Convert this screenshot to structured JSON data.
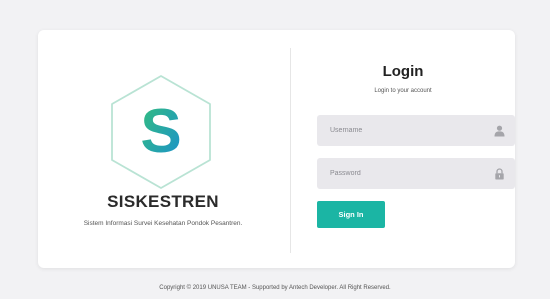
{
  "brand": {
    "logo_letter": "S",
    "name": "SISKESTREN",
    "subtitle": "Sistem Informasi Survei Kesehatan Pondok Pesantren."
  },
  "login": {
    "title": "Login",
    "subtitle": "Login to your account",
    "username_placeholder": "Username",
    "password_placeholder": "Password",
    "signin_label": "Sign In",
    "username_icon": "user-icon",
    "password_icon": "lock-icon"
  },
  "footer": {
    "text": "Copyright © 2019 UNUSA TEAM - Supported by Antech Developer. All Right Reserved."
  },
  "colors": {
    "accent": "#1bb5a4",
    "logo_gradient_start": "#35c07a",
    "logo_gradient_end": "#1a8fd0",
    "hexagon_stroke": "#b9e3d4",
    "field_bg": "#e9e8ec",
    "page_bg": "#f2f2f4"
  }
}
